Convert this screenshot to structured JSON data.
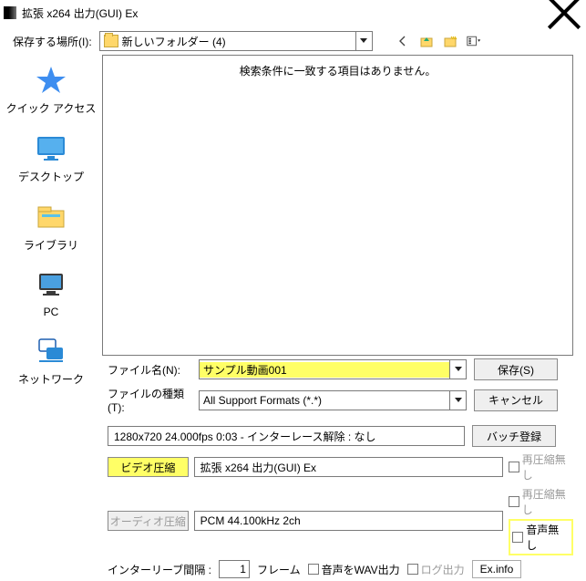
{
  "title": "拡張 x264 出力(GUI) Ex",
  "toolbar": {
    "save_in_label": "保存する場所(I):",
    "folder_name": "新しいフォルダー (4)"
  },
  "places": {
    "quick_access": "クイック アクセス",
    "desktop": "デスクトップ",
    "library": "ライブラリ",
    "pc": "PC",
    "network": "ネットワーク"
  },
  "listarea": {
    "empty_msg": "検索条件に一致する項目はありません。"
  },
  "file": {
    "name_label": "ファイル名(N):",
    "name_value": "サンプル動画001",
    "type_label": "ファイルの種類(T):",
    "type_value": "All Support Formats (*.*)",
    "save_btn": "保存(S)",
    "cancel_btn": "キャンセル"
  },
  "status": {
    "text": "1280x720  24.000fps  0:03  -  インターレース解除 : なし",
    "batch_btn": "バッチ登録"
  },
  "comp": {
    "video_btn": "ビデオ圧縮",
    "video_field": "拡張 x264 出力(GUI) Ex",
    "audio_btn": "オーディオ圧縮",
    "audio_field": "PCM 44.100kHz 2ch",
    "recompress_v": "再圧縮無し",
    "recompress_a": "再圧縮無し",
    "no_audio": "音声無し"
  },
  "bottom": {
    "interleave_label": "インターリーブ間隔 :",
    "interleave_value": "1",
    "frame_label": "フレーム",
    "wav_out": "音声をWAV出力",
    "log_out": "ログ出力",
    "exinfo": "Ex.info"
  }
}
